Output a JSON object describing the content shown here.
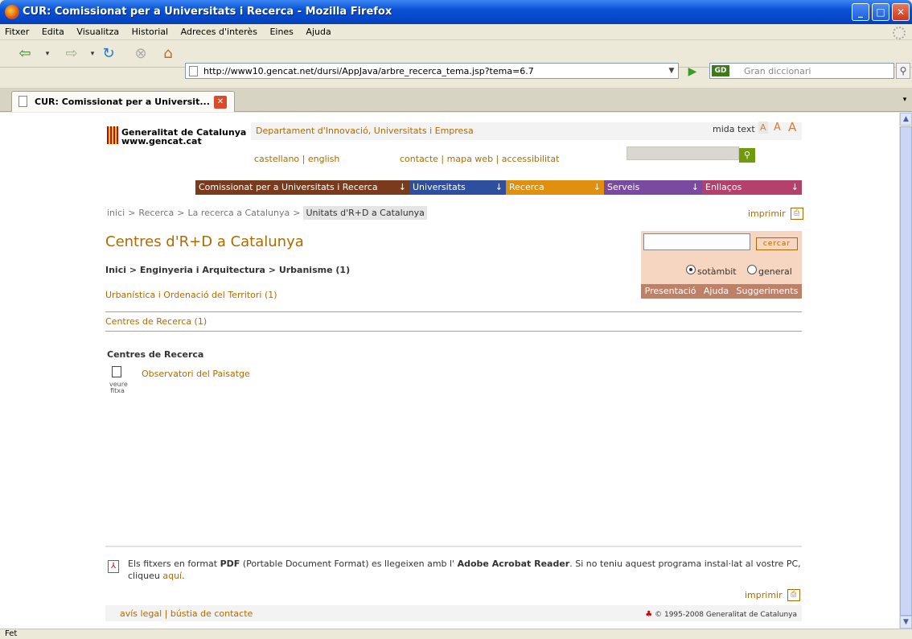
{
  "window": {
    "title": "CUR: Comissionat per a Universitats i Recerca - Mozilla Firefox",
    "minimize": "_",
    "maximize": "□",
    "close": "✕"
  },
  "menu": [
    "Fitxer",
    "Edita",
    "Visualitza",
    "Historial",
    "Adreces d'interès",
    "Eines",
    "Ajuda"
  ],
  "toolbar": {
    "url": "http://www10.gencat.net/dursi/AppJava/arbre_recerca_tema.jsp?tema=6.7",
    "search_placeholder": "Gran diccionari"
  },
  "tab": {
    "title": "CUR: Comissionat per a Universit..."
  },
  "header": {
    "logo_line1": "Generalitat de Catalunya",
    "logo_line2": "www.gencat.cat",
    "department": "Departament d'Innovació, Universitats i Empresa",
    "text_size_label": "mida text",
    "text_sizes": [
      "A",
      "A",
      "A"
    ],
    "languages": "castellano | english",
    "links": "contacte | mapa web | accessibilitat"
  },
  "nav": [
    {
      "label": "Comissionat per a Universitats i Recerca",
      "color": "#7a3b1c"
    },
    {
      "label": "Universitats",
      "color": "#2d4f9e"
    },
    {
      "label": "Recerca",
      "color": "#e0900e"
    },
    {
      "label": "Serveis",
      "color": "#7a4aa0"
    },
    {
      "label": "Enllaços",
      "color": "#b3416b"
    }
  ],
  "nav_arrow": "↓",
  "breadcrumb": {
    "items": [
      "inici",
      "Recerca",
      "La recerca a Catalunya"
    ],
    "separator": ">",
    "current": "Unitats d'R+D a Catalunya"
  },
  "print_label": "imprimir",
  "page": {
    "title": "Centres d'R+D a Catalunya",
    "trail": "Inici > Enginyeria i Arquitectura > Urbanisme (1)",
    "subtopic": "Urbanística i Ordenació del Territori (1)",
    "centres_link": "Centres de Recerca (1)",
    "section_heading": "Centres de Recerca",
    "entry": "Observatori del Paisatge",
    "view_label_1": "veure",
    "view_label_2": "fitxa"
  },
  "search_panel": {
    "button": "cercar",
    "option_1": "sotàmbit",
    "option_2": "general",
    "links": [
      "Presentació",
      "Ajuda",
      "Suggeriments"
    ]
  },
  "pdf_note": {
    "t1": "Els fitxers en format ",
    "pdf": "PDF",
    "t2": " (Portable Document Format) es llegeixen amb l' ",
    "reader": "Adobe Acrobat Reader",
    "t3": ". Si no teniu aquest programa instal·lat al vostre PC, cliqueu ",
    "link": "aquí",
    "t4": "."
  },
  "footer": {
    "links": "avís legal  |  bústia de contacte",
    "copyright": "© 1995-2008 Generalitat de Catalunya"
  },
  "status": "Fet"
}
